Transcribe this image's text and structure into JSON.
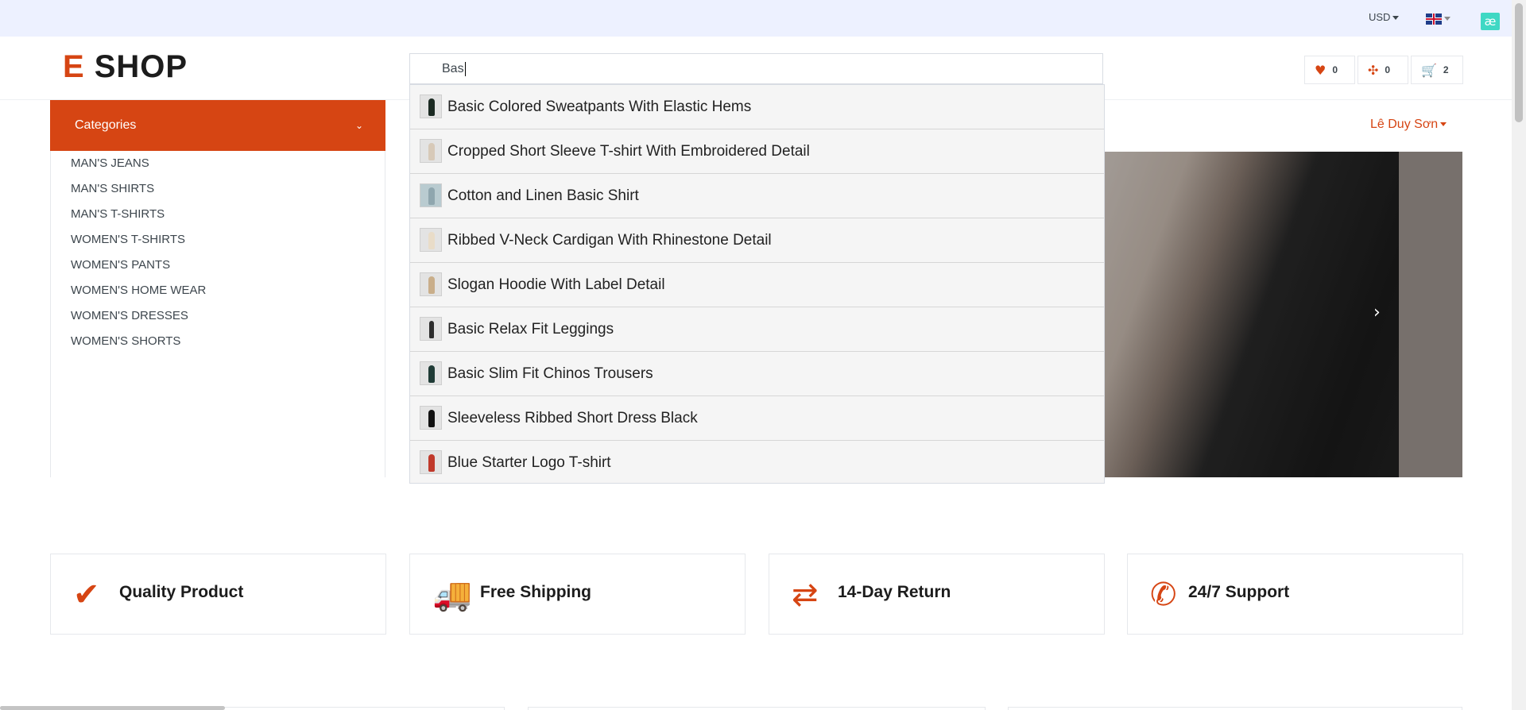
{
  "topbar": {
    "currency": "USD",
    "language_icon": "uk-flag-icon",
    "extension_icon_glyph": "æ"
  },
  "header": {
    "logo_mark": "E",
    "logo_text": "SHOP",
    "search_value": "Bas",
    "wishlist_count": "0",
    "compare_count": "0",
    "cart_count": "2"
  },
  "categories": {
    "title": "Categories",
    "items": [
      "MAN'S JEANS",
      "MAN'S SHIRTS",
      "MAN'S T-SHIRTS",
      "WOMEN'S T-SHIRTS",
      "WOMEN'S PANTS",
      "WOMEN'S HOME WEAR",
      "WOMEN'S DRESSES",
      "WOMEN'S SHORTS"
    ]
  },
  "user": {
    "name": "Lê Duy Sơn"
  },
  "search_suggestions": [
    "Basic Colored Sweatpants With Elastic Hems",
    "Cropped Short Sleeve T-shirt With Embroidered Detail",
    "Cotton and Linen Basic Shirt",
    "Ribbed V-Neck Cardigan With Rhinestone Detail",
    "Slogan Hoodie With Label Detail",
    "Basic Relax Fit Leggings",
    "Basic Slim Fit Chinos Trousers",
    "Sleeveless Ribbed Short Dress Black",
    "Blue Starter Logo T-shirt"
  ],
  "features": [
    {
      "label": "Quality Product",
      "icon": "check-icon"
    },
    {
      "label": "Free Shipping",
      "icon": "truck-icon"
    },
    {
      "label": "14-Day Return",
      "icon": "exchange-arrows-icon"
    },
    {
      "label": "24/7 Support",
      "icon": "phone-volume-icon"
    }
  ],
  "colors": {
    "accent": "#d64513",
    "topbar_bg": "#edf1ff",
    "dropdown_bg": "#f5f5f5"
  }
}
